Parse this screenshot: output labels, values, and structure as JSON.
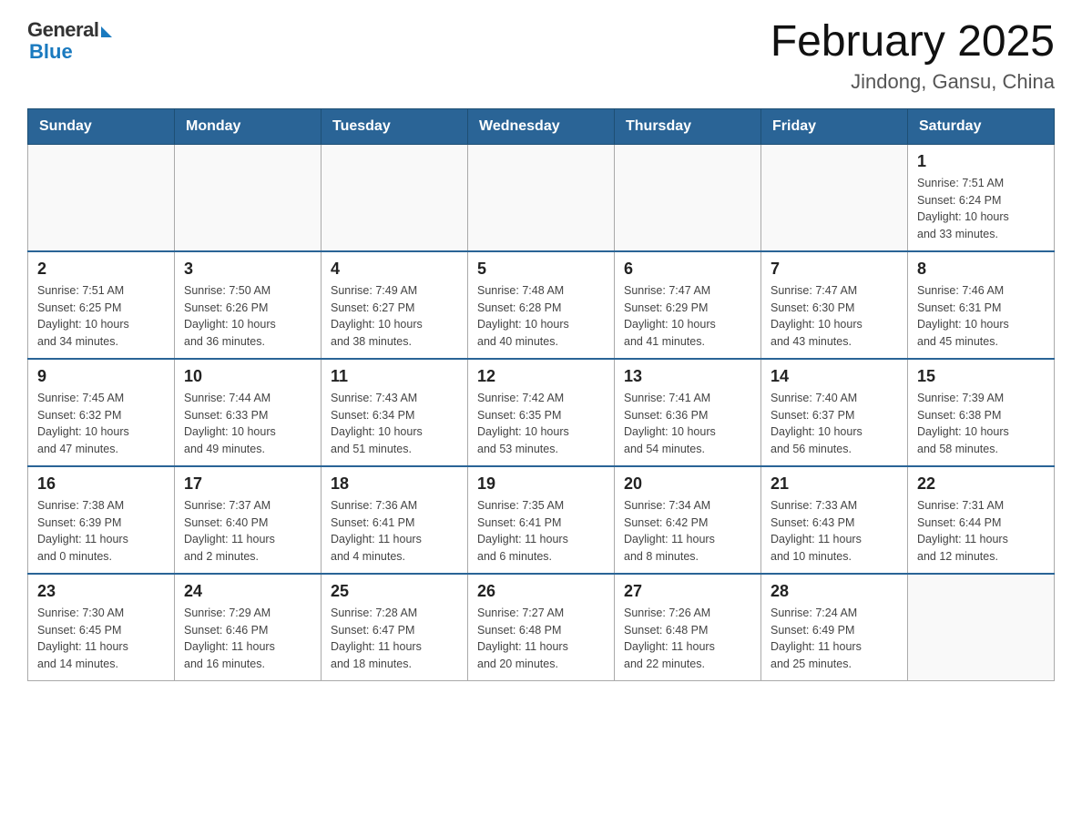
{
  "header": {
    "logo_general": "General",
    "logo_blue": "Blue",
    "title": "February 2025",
    "subtitle": "Jindong, Gansu, China"
  },
  "weekdays": [
    "Sunday",
    "Monday",
    "Tuesday",
    "Wednesday",
    "Thursday",
    "Friday",
    "Saturday"
  ],
  "weeks": [
    [
      {
        "day": "",
        "info": ""
      },
      {
        "day": "",
        "info": ""
      },
      {
        "day": "",
        "info": ""
      },
      {
        "day": "",
        "info": ""
      },
      {
        "day": "",
        "info": ""
      },
      {
        "day": "",
        "info": ""
      },
      {
        "day": "1",
        "info": "Sunrise: 7:51 AM\nSunset: 6:24 PM\nDaylight: 10 hours\nand 33 minutes."
      }
    ],
    [
      {
        "day": "2",
        "info": "Sunrise: 7:51 AM\nSunset: 6:25 PM\nDaylight: 10 hours\nand 34 minutes."
      },
      {
        "day": "3",
        "info": "Sunrise: 7:50 AM\nSunset: 6:26 PM\nDaylight: 10 hours\nand 36 minutes."
      },
      {
        "day": "4",
        "info": "Sunrise: 7:49 AM\nSunset: 6:27 PM\nDaylight: 10 hours\nand 38 minutes."
      },
      {
        "day": "5",
        "info": "Sunrise: 7:48 AM\nSunset: 6:28 PM\nDaylight: 10 hours\nand 40 minutes."
      },
      {
        "day": "6",
        "info": "Sunrise: 7:47 AM\nSunset: 6:29 PM\nDaylight: 10 hours\nand 41 minutes."
      },
      {
        "day": "7",
        "info": "Sunrise: 7:47 AM\nSunset: 6:30 PM\nDaylight: 10 hours\nand 43 minutes."
      },
      {
        "day": "8",
        "info": "Sunrise: 7:46 AM\nSunset: 6:31 PM\nDaylight: 10 hours\nand 45 minutes."
      }
    ],
    [
      {
        "day": "9",
        "info": "Sunrise: 7:45 AM\nSunset: 6:32 PM\nDaylight: 10 hours\nand 47 minutes."
      },
      {
        "day": "10",
        "info": "Sunrise: 7:44 AM\nSunset: 6:33 PM\nDaylight: 10 hours\nand 49 minutes."
      },
      {
        "day": "11",
        "info": "Sunrise: 7:43 AM\nSunset: 6:34 PM\nDaylight: 10 hours\nand 51 minutes."
      },
      {
        "day": "12",
        "info": "Sunrise: 7:42 AM\nSunset: 6:35 PM\nDaylight: 10 hours\nand 53 minutes."
      },
      {
        "day": "13",
        "info": "Sunrise: 7:41 AM\nSunset: 6:36 PM\nDaylight: 10 hours\nand 54 minutes."
      },
      {
        "day": "14",
        "info": "Sunrise: 7:40 AM\nSunset: 6:37 PM\nDaylight: 10 hours\nand 56 minutes."
      },
      {
        "day": "15",
        "info": "Sunrise: 7:39 AM\nSunset: 6:38 PM\nDaylight: 10 hours\nand 58 minutes."
      }
    ],
    [
      {
        "day": "16",
        "info": "Sunrise: 7:38 AM\nSunset: 6:39 PM\nDaylight: 11 hours\nand 0 minutes."
      },
      {
        "day": "17",
        "info": "Sunrise: 7:37 AM\nSunset: 6:40 PM\nDaylight: 11 hours\nand 2 minutes."
      },
      {
        "day": "18",
        "info": "Sunrise: 7:36 AM\nSunset: 6:41 PM\nDaylight: 11 hours\nand 4 minutes."
      },
      {
        "day": "19",
        "info": "Sunrise: 7:35 AM\nSunset: 6:41 PM\nDaylight: 11 hours\nand 6 minutes."
      },
      {
        "day": "20",
        "info": "Sunrise: 7:34 AM\nSunset: 6:42 PM\nDaylight: 11 hours\nand 8 minutes."
      },
      {
        "day": "21",
        "info": "Sunrise: 7:33 AM\nSunset: 6:43 PM\nDaylight: 11 hours\nand 10 minutes."
      },
      {
        "day": "22",
        "info": "Sunrise: 7:31 AM\nSunset: 6:44 PM\nDaylight: 11 hours\nand 12 minutes."
      }
    ],
    [
      {
        "day": "23",
        "info": "Sunrise: 7:30 AM\nSunset: 6:45 PM\nDaylight: 11 hours\nand 14 minutes."
      },
      {
        "day": "24",
        "info": "Sunrise: 7:29 AM\nSunset: 6:46 PM\nDaylight: 11 hours\nand 16 minutes."
      },
      {
        "day": "25",
        "info": "Sunrise: 7:28 AM\nSunset: 6:47 PM\nDaylight: 11 hours\nand 18 minutes."
      },
      {
        "day": "26",
        "info": "Sunrise: 7:27 AM\nSunset: 6:48 PM\nDaylight: 11 hours\nand 20 minutes."
      },
      {
        "day": "27",
        "info": "Sunrise: 7:26 AM\nSunset: 6:48 PM\nDaylight: 11 hours\nand 22 minutes."
      },
      {
        "day": "28",
        "info": "Sunrise: 7:24 AM\nSunset: 6:49 PM\nDaylight: 11 hours\nand 25 minutes."
      },
      {
        "day": "",
        "info": ""
      }
    ]
  ]
}
